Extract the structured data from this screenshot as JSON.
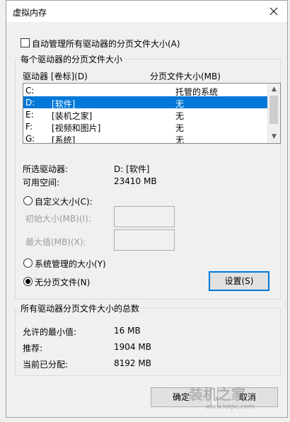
{
  "window": {
    "title": "虚拟内存",
    "close": "✕"
  },
  "auto_manage": {
    "label": "自动管理所有驱动器的分页文件大小(A)",
    "checked": false
  },
  "group_each": {
    "title": "每个驱动器的分页文件大小",
    "col_drive": "驱动器 [卷标](D)",
    "col_size": "分页文件大小(MB)",
    "rows": [
      {
        "drive": "C:",
        "label": "",
        "size": "托管的系统"
      },
      {
        "drive": "D:",
        "label": "[软件]",
        "size": "无"
      },
      {
        "drive": "E:",
        "label": "[装机之家]",
        "size": "无"
      },
      {
        "drive": "F:",
        "label": "[视频和图片]",
        "size": "无"
      },
      {
        "drive": "G:",
        "label": "[系统]",
        "size": "无"
      }
    ],
    "selected_drive_label": "所选驱动器:",
    "selected_drive_value": "D:  [软件]",
    "free_space_label": "可用空间:",
    "free_space_value": "23410 MB",
    "custom_size": "自定义大小(C):",
    "initial_size": "初始大小(MB)(I):",
    "max_size": "最大值(MB)(X):",
    "system_managed": "系统管理的大小(Y)",
    "no_paging": "无分页文件(N)",
    "set_button": "设置(S)"
  },
  "group_total": {
    "title": "所有驱动器分页文件大小的总数",
    "min_label": "允许的最小值:",
    "min_value": "16 MB",
    "rec_label": "推荐:",
    "rec_value": "1904 MB",
    "cur_label": "当前已分配:",
    "cur_value": "8192 MB"
  },
  "buttons": {
    "ok": "确定",
    "cancel": "取消"
  },
  "watermark": {
    "text": "装机之家",
    "url": "www.lotpc.com"
  }
}
